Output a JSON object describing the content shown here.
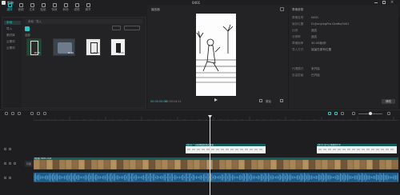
{
  "app": {
    "title": "剪映",
    "project_name": "0401"
  },
  "toolbar": {
    "items": [
      {
        "label": "媒体"
      },
      {
        "label": "音频"
      },
      {
        "label": "文本"
      },
      {
        "label": "贴纸"
      },
      {
        "label": "特效"
      },
      {
        "label": "转场"
      },
      {
        "label": "滤镜"
      },
      {
        "label": "调节"
      }
    ]
  },
  "media": {
    "nav": [
      {
        "label": "本地"
      },
      {
        "label": "导入"
      },
      {
        "label": "素材库"
      },
      {
        "label": "云素材"
      },
      {
        "label": "云素材"
      }
    ],
    "breadcrumb": "本地 · 导入",
    "section_label": "全部",
    "thumb_durations": [
      "00:05",
      "00:06",
      "00:04",
      "00:09"
    ]
  },
  "player": {
    "title": "播放器",
    "current_time": "00:00:00:00",
    "total_time": "00:00:24:11",
    "ratio_label": "原始"
  },
  "properties": {
    "title": "草稿参数",
    "rows": [
      {
        "key": "草稿名称",
        "value": "0401"
      },
      {
        "key": "保存位置",
        "value": "D:/JianyingPro Drafts/0401"
      },
      {
        "key": "比例",
        "value": "适应"
      },
      {
        "key": "分辨率",
        "value": "适应"
      },
      {
        "key": "草稿帧率",
        "value": "30.00帧/秒"
      },
      {
        "key": "导入方式",
        "value": "保留在原有位置"
      },
      {
        "key": "代理模式",
        "value": "未开启"
      },
      {
        "key": "自由层级",
        "value": "已开启"
      }
    ],
    "modify_button": "修改"
  },
  "timeline": {
    "track_labels": [
      "封面"
    ],
    "text_clips": [
      "[文字] 一只猫咪慢悠悠走过来",
      "[文字] 主人正在收拾行李"
    ],
    "video_label": "[视频] 0401.mp4"
  },
  "colors": {
    "accent": "#2fc4c9",
    "text_clip": "#145d5f",
    "audio": "#1d5b89",
    "video": "#9b7b54"
  }
}
